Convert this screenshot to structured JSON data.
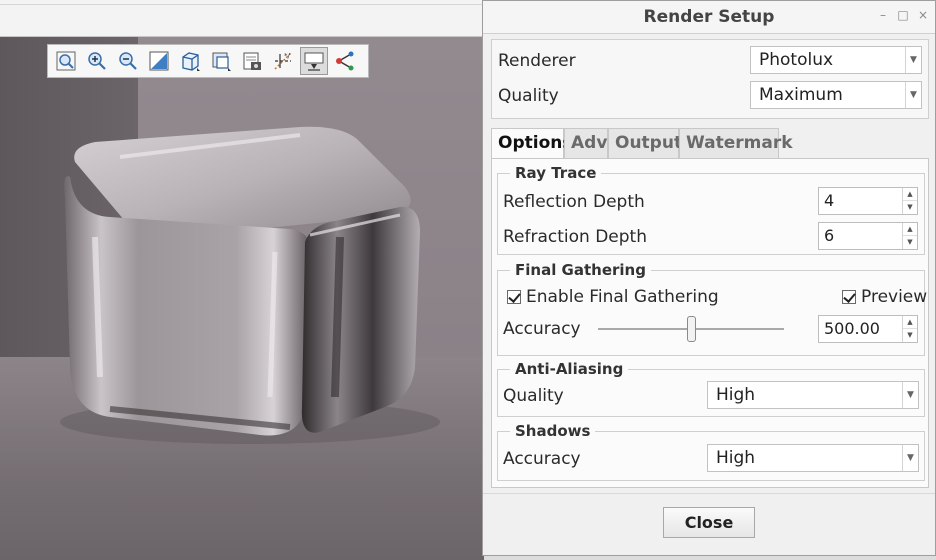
{
  "dialog": {
    "title": "Render Setup",
    "renderer_label": "Renderer",
    "renderer_value": "Photolux",
    "quality_label": "Quality",
    "quality_value": "Maximum",
    "tabs": [
      {
        "label": "Options",
        "active": true
      },
      {
        "label": "Adv",
        "active": false
      },
      {
        "label": "Output",
        "active": false
      },
      {
        "label": "Watermark",
        "active": false
      }
    ],
    "ray_trace": {
      "title": "Ray Trace",
      "reflection_label": "Reflection Depth",
      "reflection_value": "4",
      "refraction_label": "Refraction Depth",
      "refraction_value": "6"
    },
    "final_gathering": {
      "title": "Final Gathering",
      "enable_label": "Enable Final Gathering",
      "enable_checked": true,
      "preview_label": "Preview",
      "preview_checked": true,
      "accuracy_label": "Accuracy",
      "accuracy_value": "500.00",
      "accuracy_slider_fraction": 0.5
    },
    "anti_aliasing": {
      "title": "Anti-Aliasing",
      "quality_label": "Quality",
      "quality_value": "High"
    },
    "shadows": {
      "title": "Shadows",
      "accuracy_label": "Accuracy",
      "accuracy_value": "High"
    },
    "close_label": "Close"
  },
  "viewport_toolbar": {
    "buttons": [
      {
        "icon": "zoom-fit-icon"
      },
      {
        "icon": "zoom-in-icon"
      },
      {
        "icon": "zoom-out-icon"
      },
      {
        "icon": "repaint-icon"
      },
      {
        "icon": "saved-orientations-icon"
      },
      {
        "icon": "view-manager-icon"
      },
      {
        "icon": "display-style-icon"
      },
      {
        "icon": "datum-display-icon"
      },
      {
        "icon": "render-region-icon",
        "active": true
      },
      {
        "icon": "spin-center-icon"
      }
    ]
  },
  "colors": {
    "accent": "#2a6db5",
    "glass": "#d9d4d8"
  }
}
